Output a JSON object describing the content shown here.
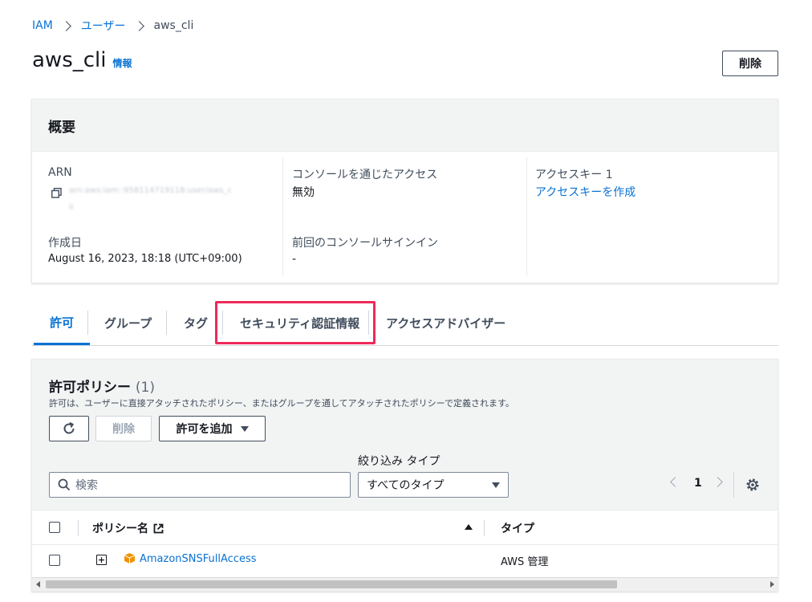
{
  "breadcrumb": {
    "iam": "IAM",
    "users": "ユーザー",
    "current": "aws_cli"
  },
  "page": {
    "title": "aws_cli",
    "info": "情報",
    "delete_label": "削除"
  },
  "summary": {
    "header": "概要",
    "arn_label": "ARN",
    "arn_value_line1": "arn:aws:iam::958114719118:user/aws_c",
    "arn_value_line2": "li",
    "created_label": "作成日",
    "created_value": "August 16, 2023, 18:18 (UTC+09:00)",
    "console_access_label": "コンソールを通じたアクセス",
    "console_access_value": "無効",
    "last_signin_label": "前回のコンソールサインイン",
    "last_signin_value": "-",
    "access_key_label": "アクセスキー 1",
    "access_key_link": "アクセスキーを作成"
  },
  "tabs": [
    "許可",
    "グループ",
    "タグ",
    "セキュリティ認証情報",
    "アクセスアドバイザー"
  ],
  "permissions": {
    "title": "許可ポリシー",
    "count": "(1)",
    "description": "許可は、ユーザーに直接アタッチされたポリシー、またはグループを通してアタッチされたポリシーで定義されます。",
    "delete_label": "削除",
    "add_label": "許可を追加",
    "filter_type_label": "絞り込み タイプ",
    "search_placeholder": "検索",
    "type_select_value": "すべてのタイプ",
    "page_number": "1",
    "columns": {
      "policy_name": "ポリシー名",
      "type": "タイプ"
    },
    "rows": [
      {
        "name": "AmazonSNSFullAccess",
        "type": "AWS 管理"
      }
    ]
  },
  "colors": {
    "link": "#0972d3",
    "highlight": "#ee2a5a",
    "aws_orange": "#f29100"
  }
}
